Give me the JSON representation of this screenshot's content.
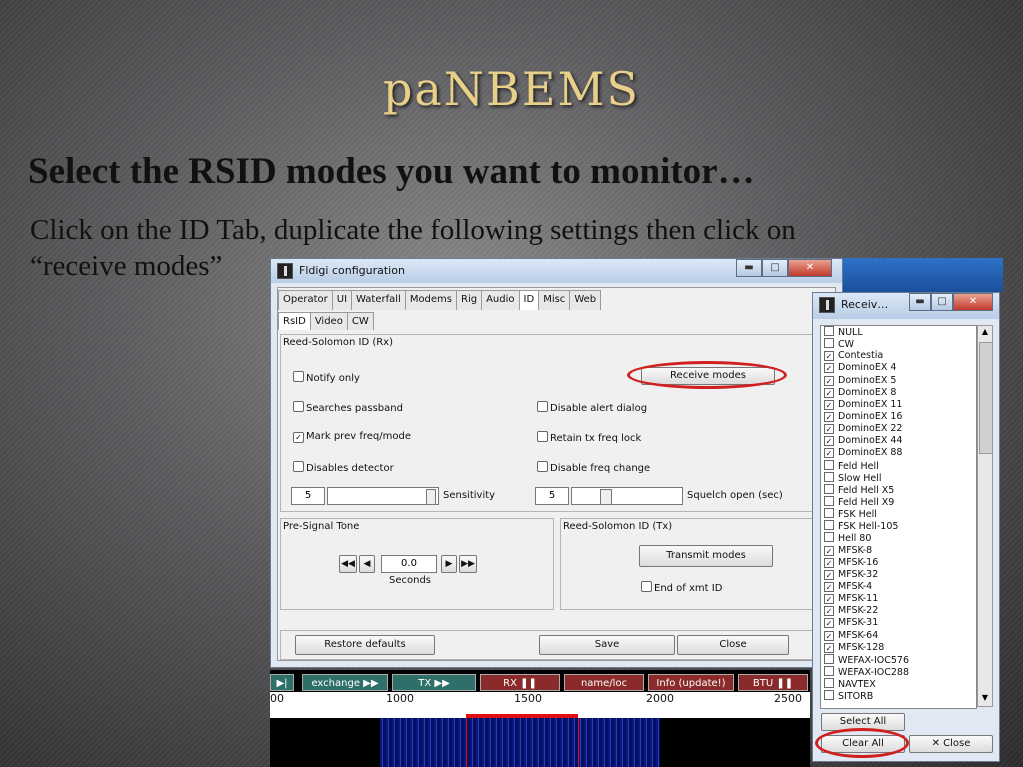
{
  "slide": {
    "title": "paNBEMS",
    "subtitle": "Select the RSID modes you want to monitor…",
    "body_line1": "Click on the ID Tab, duplicate the following settings then click on",
    "body_line2": "“receive modes”"
  },
  "config_dialog": {
    "title": "Fldigi configuration",
    "tabs": [
      "Operator",
      "UI",
      "Waterfall",
      "Modems",
      "Rig",
      "Audio",
      "ID",
      "Misc",
      "Web"
    ],
    "active_tab": "ID",
    "subtabs": [
      "RsID",
      "Video",
      "CW"
    ],
    "active_subtab": "RsID",
    "rx_group": "Reed-Solomon ID (Rx)",
    "notify_only": "Notify only",
    "receive_modes": "Receive modes",
    "searches_passband": "Searches passband",
    "disable_alert": "Disable alert dialog",
    "mark_prev": "Mark prev freq/mode",
    "retain_tx": "Retain tx freq lock",
    "disables_detector": "Disables detector",
    "disable_freq_change": "Disable freq change",
    "sensitivity_value": "5",
    "sensitivity_label": "Sensitivity",
    "squelch_value": "5",
    "squelch_label": "Squelch open (sec)",
    "presignal_group": "Pre-Signal Tone",
    "presignal_value": "0.0",
    "seconds_label": "Seconds",
    "tx_group": "Reed-Solomon ID (Tx)",
    "transmit_modes": "Transmit modes",
    "end_of_xmt": "End of xmt ID",
    "restore_defaults": "Restore defaults",
    "save": "Save",
    "close": "Close",
    "checkbox_states": {
      "mark_prev": true
    }
  },
  "main_window": {
    "buttons": [
      "exchange",
      "TX",
      "RX",
      "name/loc",
      "Info (update!)",
      "BTU"
    ],
    "scale_ticks": [
      "00",
      "1000",
      "1500",
      "2000",
      "2500"
    ]
  },
  "receive_dialog": {
    "title": "Receiv…",
    "modes": [
      {
        "name": "NULL",
        "checked": false
      },
      {
        "name": "CW",
        "checked": false
      },
      {
        "name": "Contestia",
        "checked": true
      },
      {
        "name": "DominoEX 4",
        "checked": true
      },
      {
        "name": "DominoEX 5",
        "checked": true
      },
      {
        "name": "DominoEX 8",
        "checked": true
      },
      {
        "name": "DominoEX 11",
        "checked": true
      },
      {
        "name": "DominoEX 16",
        "checked": true
      },
      {
        "name": "DominoEX 22",
        "checked": true
      },
      {
        "name": "DominoEX 44",
        "checked": true
      },
      {
        "name": "DominoEX 88",
        "checked": true
      },
      {
        "name": "Feld Hell",
        "checked": false
      },
      {
        "name": "Slow Hell",
        "checked": false
      },
      {
        "name": "Feld Hell X5",
        "checked": false
      },
      {
        "name": "Feld Hell X9",
        "checked": false
      },
      {
        "name": "FSK Hell",
        "checked": false
      },
      {
        "name": "FSK Hell-105",
        "checked": false
      },
      {
        "name": "Hell 80",
        "checked": false
      },
      {
        "name": "MFSK-8",
        "checked": true
      },
      {
        "name": "MFSK-16",
        "checked": true
      },
      {
        "name": "MFSK-32",
        "checked": true
      },
      {
        "name": "MFSK-4",
        "checked": true
      },
      {
        "name": "MFSK-11",
        "checked": true
      },
      {
        "name": "MFSK-22",
        "checked": true
      },
      {
        "name": "MFSK-31",
        "checked": true
      },
      {
        "name": "MFSK-64",
        "checked": true
      },
      {
        "name": "MFSK-128",
        "checked": true
      },
      {
        "name": "WEFAX-IOC576",
        "checked": false
      },
      {
        "name": "WEFAX-IOC288",
        "checked": false
      },
      {
        "name": "NAVTEX",
        "checked": false
      },
      {
        "name": "SITORB",
        "checked": false
      }
    ],
    "select_all": "Select All",
    "clear_all": "Clear All",
    "close": "Close"
  }
}
